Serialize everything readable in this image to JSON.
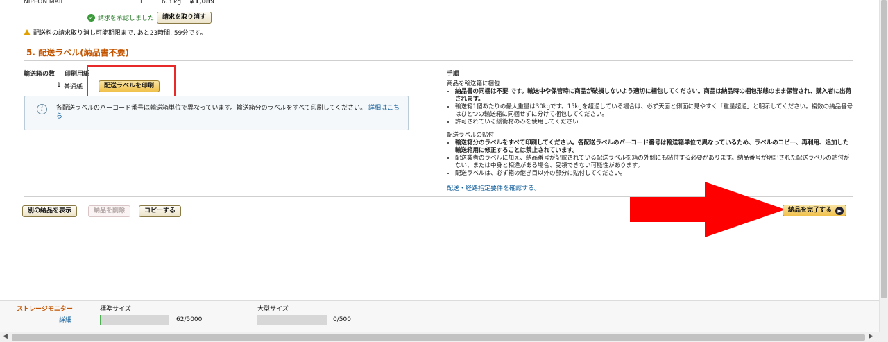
{
  "shipment_row": {
    "carrier": "NIPPON MAIL",
    "count": "1",
    "weight": "6.3 kg",
    "cost": "￥1,089"
  },
  "request": {
    "approved_text": "請求を承認しました",
    "cancel_button": "請求を取り消す",
    "deadline_notice": "配送料の請求取り消し可能期限まで, あと23時間, 59分です。"
  },
  "section_title": "5. 配送ラベル(納品書不要)",
  "label_table": {
    "col_boxes": "輸送箱の数",
    "col_paper": "印刷用紙",
    "box_count": "1",
    "paper_type": "普通紙",
    "print_button": "配送ラベルを印刷"
  },
  "info_box": {
    "text": "各配送ラベルのバーコード番号は輸送箱単位で異なっています。輸送箱分のラベルをすべて印刷してください。",
    "link": "詳細はこちら"
  },
  "procedure": {
    "heading": "手順",
    "packing_heading": "商品を輸送箱に梱包",
    "packing_items": [
      "納品書の同梱は不要 です。輸送中や保管時に商品が破損しないよう適切に梱包してください。商品は納品時の梱包形態のまま保管され、購入者に出荷されます。",
      "輸送箱1個あたりの最大重量は30kgです。15kgを超過している場合は、必ず天面と側面に見やすく「重量超過」と明示してください。複数の納品番号はひとつの輸送箱に同梱せずに分けて梱包してください。",
      "許可されている緩衝材のみを使用してください"
    ],
    "label_heading": "配送ラベルの貼付",
    "label_items": [
      "輸送箱分のラベルをすべて印刷してください。各配送ラベルのバーコード番号は輸送箱単位で異なっているため、ラベルのコピー、再利用、追加した輸送箱用に修正することは禁止されています。",
      "配送業者のラベルに加え、納品番号が記載されている配送ラベルを箱の外側にも貼付する必要があります。納品番号が明記された配送ラベルの貼付がない、または中身と相違がある場合、受領できない可能性があります。",
      "配送ラベルは、必ず箱の継ぎ目以外の部分に貼付してください。"
    ],
    "requirements_link": "配送・経路指定要件を確認する。"
  },
  "actions": {
    "view_other": "別の納品を表示",
    "delete": "納品を削除",
    "copy": "コピーする",
    "complete": "納品を完了する"
  },
  "storage": {
    "title": "ストレージモニター",
    "detail_link": "詳細",
    "standard_label": "標準サイズ",
    "standard_value": "62/5000",
    "standard_fraction": 0.0124,
    "oversize_label": "大型サイズ",
    "oversize_value": "0/500",
    "oversize_fraction": 0
  },
  "colors": {
    "section_title": "#c45500",
    "highlight_box": "#e8292a",
    "arrow": "#ff0000",
    "link": "#0d5c99"
  }
}
